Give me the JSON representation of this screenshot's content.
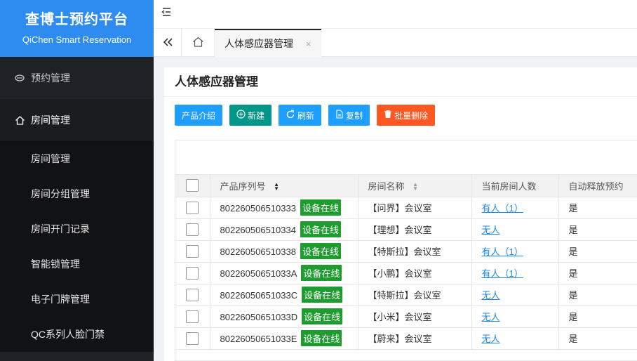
{
  "brand": {
    "title": "查博士预约平台",
    "subtitle": "QiChen Smart Reservation"
  },
  "sidebar": {
    "groups": [
      {
        "label": "预约管理",
        "icon": "reservation-icon"
      },
      {
        "label": "房间管理",
        "icon": "home-icon"
      }
    ],
    "items": [
      {
        "label": "房间管理"
      },
      {
        "label": "房间分组管理"
      },
      {
        "label": "房间开门记录"
      },
      {
        "label": "智能锁管理"
      },
      {
        "label": "电子门牌管理"
      },
      {
        "label": "QC系列人脸门禁"
      }
    ]
  },
  "tabs": {
    "active": "人体感应器管理",
    "close": "×"
  },
  "page": {
    "title": "人体感应器管理"
  },
  "toolbar": {
    "intro": "产品介绍",
    "new": "新建",
    "refresh": "刷新",
    "copy": "复制",
    "batch_delete": "批量删除"
  },
  "table": {
    "headers": {
      "serial": "产品序列号",
      "room": "房间名称",
      "occupancy": "当前房间人数",
      "auto_release": "自动释放预约"
    },
    "rows": [
      {
        "serial": "802260506510333",
        "status": "设备在线",
        "room": "【问界】会议室",
        "occupancy": "有人（1）",
        "auto_release": "是"
      },
      {
        "serial": "802260506510334",
        "status": "设备在线",
        "room": "【理想】会议室",
        "occupancy": "无人",
        "auto_release": "是"
      },
      {
        "serial": "802260506510338",
        "status": "设备在线",
        "room": "【特斯拉】会议室",
        "occupancy": "有人（1）",
        "auto_release": "是"
      },
      {
        "serial": "80226050651033A",
        "status": "设备在线",
        "room": "【小鹏】会议室",
        "occupancy": "有人（1）",
        "auto_release": "是"
      },
      {
        "serial": "80226050651033C",
        "status": "设备在线",
        "room": "【特斯拉】会议室",
        "occupancy": "无人",
        "auto_release": "是"
      },
      {
        "serial": "80226050651033D",
        "status": "设备在线",
        "room": "【小米】会议室",
        "occupancy": "无人",
        "auto_release": "是"
      },
      {
        "serial": "80226050651033E",
        "status": "设备在线",
        "room": "【蔚来】会议室",
        "occupancy": "无人",
        "auto_release": "是"
      }
    ]
  },
  "colors": {
    "brand": "#2e8cf0",
    "sidebar": "#1f2226",
    "online": "#1f9c2f",
    "primary": "#1e9fff",
    "success": "#009688",
    "danger": "#ff5722"
  }
}
